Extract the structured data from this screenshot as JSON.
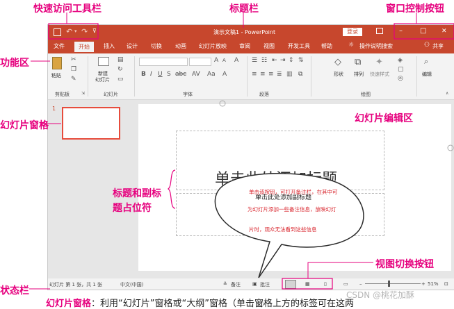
{
  "annotations": {
    "quick_access": "快速访问工具栏",
    "title_bar": "标题栏",
    "window_controls": "窗口控制按钮",
    "ribbon": "功能区",
    "slide_pane": "幻灯片窗格",
    "slide_edit": "幻灯片编辑区",
    "placeholders_line1": "标题和副标",
    "placeholders_line2": "题占位符",
    "view_switch": "视图切换按钮",
    "status_bar": "状态栏"
  },
  "window": {
    "title": "演示文稿1 - PowerPoint",
    "login_button": "登录",
    "controls": {
      "minimize": "–",
      "restore": "□",
      "close": "✕"
    }
  },
  "tabs": [
    "文件",
    "开始",
    "插入",
    "设计",
    "切换",
    "动画",
    "幻灯片放映",
    "审阅",
    "视图",
    "开发工具",
    "帮助"
  ],
  "tell_me": "操作说明搜索",
  "share": "共享",
  "ribbon": {
    "paste": "粘贴",
    "clipboard_group": "剪贴板",
    "new_slide_line1": "新建",
    "new_slide_line2": "幻灯片",
    "slides_group": "幻灯片",
    "font_group": "字体",
    "paragraph_group": "段落",
    "shape": "形状",
    "arrange": "排列",
    "quick_styles": "快速样式",
    "drawing_group": "绘图",
    "edit": "编辑"
  },
  "thumbnail_number": "1",
  "slide": {
    "title_placeholder": "单击此处添加标题",
    "subtitle_placeholder": "单击此处添加副标题",
    "notes_line1": "单击该按钮，可打开备注栏，在其中可",
    "notes_line2": "为幻灯片添加一些备注信息，放映幻灯",
    "notes_line3": "片时，观众无法看到这些信息"
  },
  "status": {
    "slide_info": "幻灯片 第 1 张，共 1 张",
    "language": "中文(中国)",
    "notes_button": "备注",
    "comments_button": "批注",
    "zoom": "51%"
  },
  "caption": {
    "term": "幻灯片窗格",
    "text": "：利用“幻灯片”窗格或“大纲”窗格（单击窗格上方的标签可在这两"
  },
  "watermark": "CSDN @桃花加酥"
}
